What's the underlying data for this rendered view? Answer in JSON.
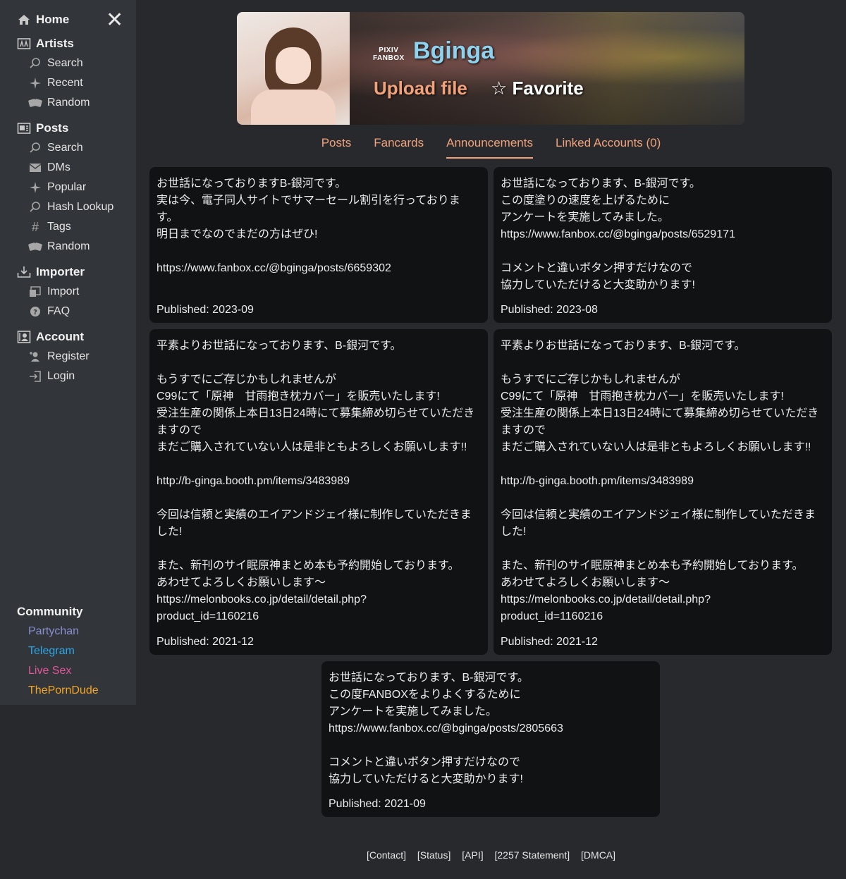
{
  "sidebar": {
    "home": "Home",
    "artists": {
      "title": "Artists",
      "items": [
        {
          "label": "Search",
          "icon": "search-icon"
        },
        {
          "label": "Recent",
          "icon": "sparkle-icon"
        },
        {
          "label": "Random",
          "icon": "dice-icon"
        }
      ]
    },
    "posts": {
      "title": "Posts",
      "items": [
        {
          "label": "Search",
          "icon": "search-icon"
        },
        {
          "label": "DMs",
          "icon": "mail-icon"
        },
        {
          "label": "Popular",
          "icon": "sparkle-icon"
        },
        {
          "label": "Hash Lookup",
          "icon": "search-icon"
        },
        {
          "label": "Tags",
          "icon": "hash-icon"
        },
        {
          "label": "Random",
          "icon": "dice-icon"
        }
      ]
    },
    "importer": {
      "title": "Importer",
      "items": [
        {
          "label": "Import",
          "icon": "import-icon"
        },
        {
          "label": "FAQ",
          "icon": "faq-icon"
        }
      ]
    },
    "account": {
      "title": "Account",
      "items": [
        {
          "label": "Register",
          "icon": "register-icon"
        },
        {
          "label": "Login",
          "icon": "login-icon"
        }
      ]
    },
    "community": {
      "title": "Community",
      "links": [
        {
          "label": "Partychan",
          "color": "#8a8fd0"
        },
        {
          "label": "Telegram",
          "color": "#2ea6e6"
        },
        {
          "label": "Live Sex",
          "color": "#e5559a"
        },
        {
          "label": "ThePornDude",
          "color": "#f5a623"
        }
      ]
    }
  },
  "banner": {
    "logo_line1": "PIXIV",
    "logo_line2": "FANBOX",
    "name": "Bginga",
    "upload": "Upload file",
    "favorite": "☆ Favorite"
  },
  "tabs": [
    {
      "label": "Posts",
      "active": false
    },
    {
      "label": "Fancards",
      "active": false
    },
    {
      "label": "Announcements",
      "active": true
    },
    {
      "label": "Linked Accounts (0)",
      "active": false
    }
  ],
  "announcements": [
    {
      "content": "お世話になっておりますB-銀河です。\n実は今、電子同人サイトでサマーセール割引を行っております。\n明日までなのでまだの方はぜひ!\n\nhttps://www.fanbox.cc/@bginga/posts/6659302",
      "published": "Published: 2023-09"
    },
    {
      "content": "お世話になっております、B-銀河です。\nこの度塗りの速度を上げるために\nアンケートを実施してみました。\nhttps://www.fanbox.cc/@bginga/posts/6529171\n\nコメントと違いボタン押すだけなので\n協力していただけると大変助かります!",
      "published": "Published: 2023-08"
    },
    {
      "content": "平素よりお世話になっております、B-銀河です。\n\nもうすでにご存じかもしれませんが\nC99にて「原神　甘雨抱き枕カバー」を販売いたします!\n受注生産の関係上本日13日24時にて募集締め切らせていただきますので\nまだご購入されていない人は是非ともよろしくお願いします!!\n\nhttp://b-ginga.booth.pm/items/3483989\n\n今回は信頼と実績のエイアンドジェイ様に制作していただきました!\n\nまた、新刊のサイ眠原神まとめ本も予約開始しております。\nあわせてよろしくお願いします～\nhttps://melonbooks.co.jp/detail/detail.php?\nproduct_id=1160216",
      "published": "Published: 2021-12"
    },
    {
      "content": "平素よりお世話になっております、B-銀河です。\n\nもうすでにご存じかもしれませんが\nC99にて「原神　甘雨抱き枕カバー」を販売いたします!\n受注生産の関係上本日13日24時にて募集締め切らせていただきますので\nまだご購入されていない人は是非ともよろしくお願いします!!\n\nhttp://b-ginga.booth.pm/items/3483989\n\n今回は信頼と実績のエイアンドジェイ様に制作していただきました!\n\nまた、新刊のサイ眠原神まとめ本も予約開始しております。\nあわせてよろしくお願いします～\nhttps://melonbooks.co.jp/detail/detail.php?\nproduct_id=1160216",
      "published": "Published: 2021-12"
    },
    {
      "content": "お世話になっております、B-銀河です。\nこの度FANBOXをよりよくするために\nアンケートを実施してみました。\nhttps://www.fanbox.cc/@bginga/posts/2805663\n\nコメントと違いボタン押すだけなので\n協力していただけると大変助かります!",
      "published": "Published: 2021-09"
    }
  ],
  "footer": [
    "[Contact]",
    "[Status]",
    "[API]",
    "[2257 Statement]",
    "[DMCA]"
  ]
}
